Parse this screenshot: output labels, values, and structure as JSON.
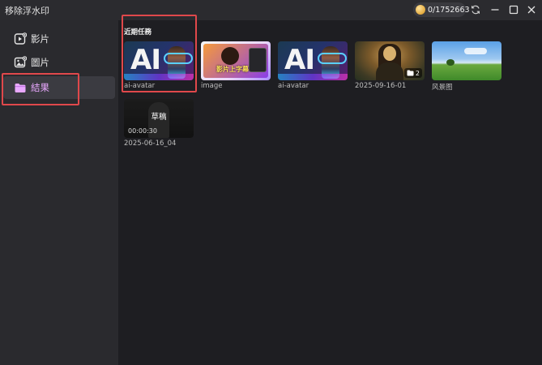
{
  "app": {
    "title": "移除浮水印",
    "credits": "0/1752663",
    "controls": {
      "refresh_icon": "refresh-icon",
      "minimize_icon": "minimize-icon",
      "maximize_icon": "maximize-icon",
      "close_icon": "close-icon"
    }
  },
  "sidebar": {
    "items": [
      {
        "label": "影片",
        "icon": "video-icon",
        "active": false
      },
      {
        "label": "圖片",
        "icon": "image-icon",
        "active": false
      },
      {
        "label": "結果",
        "icon": "folder-icon",
        "active": true
      }
    ]
  },
  "main": {
    "section_title": "近期任務",
    "tasks": [
      {
        "label": "ai-avatar",
        "thumb_type": "ai-avatar"
      },
      {
        "label": "image",
        "thumb_type": "image",
        "caption": "影片上字幕"
      },
      {
        "label": "ai-avatar",
        "thumb_type": "ai-avatar"
      },
      {
        "label": "2025-09-16-01",
        "thumb_type": "painting",
        "badge_count": "2"
      },
      {
        "label": "风景图",
        "thumb_type": "landscape"
      },
      {
        "label": "2025-06-16_04",
        "thumb_type": "draft",
        "draft_label": "草稿",
        "duration": "00:00:30"
      }
    ]
  },
  "colors": {
    "accent_active": "#e9a8ff",
    "highlight_box": "#e0484b",
    "background": "#1e1e22",
    "sidebar": "#2a2a2e"
  }
}
